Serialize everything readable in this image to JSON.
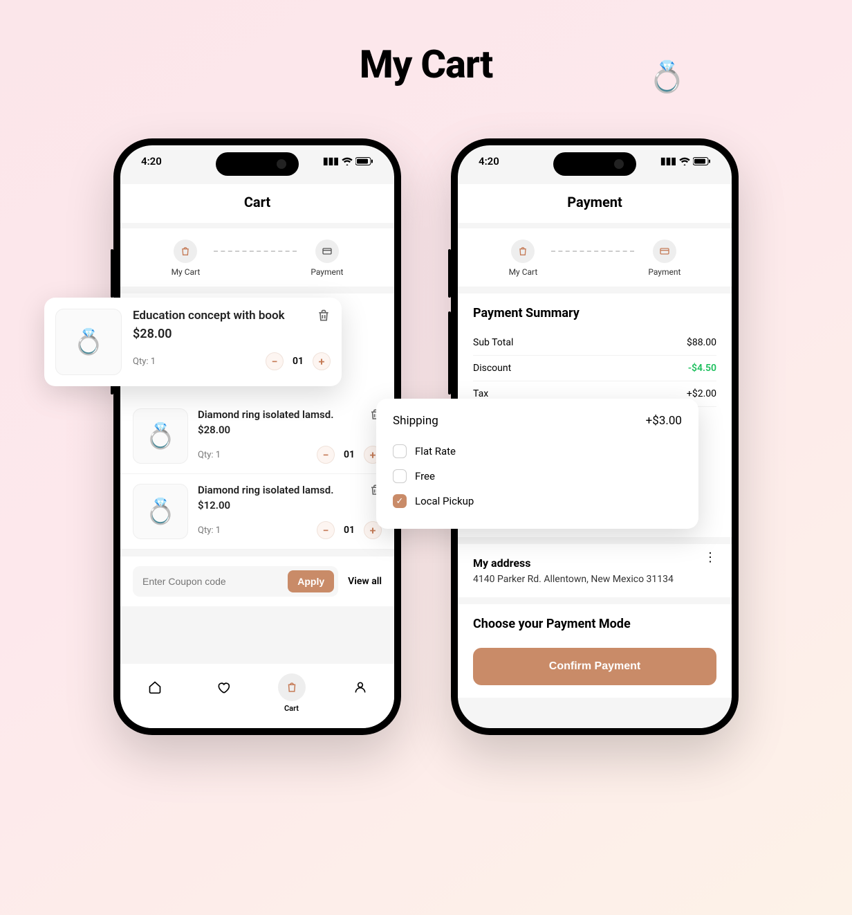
{
  "canvas": {
    "title": "My Cart"
  },
  "status": {
    "time": "4:20"
  },
  "screen1": {
    "header": "Cart",
    "steps": {
      "cart": "My Cart",
      "payment": "Payment"
    },
    "featured": {
      "title": "Education concept with book",
      "price": "$28.00",
      "qty_label": "Qty: 1",
      "qty_value": "01"
    },
    "items": [
      {
        "title": "Diamond ring isolated lamsd.",
        "price": "$28.00",
        "qty_label": "Qty: 1",
        "qty_value": "01"
      },
      {
        "title": "Diamond ring isolated lamsd.",
        "price": "$12.00",
        "qty_label": "Qty: 1",
        "qty_value": "01"
      }
    ],
    "coupon_placeholder": "Enter Coupon code",
    "apply": "Apply",
    "viewall": "View all",
    "nav": {
      "cart": "Cart"
    }
  },
  "screen2": {
    "header": "Payment",
    "steps": {
      "cart": "My Cart",
      "payment": "Payment"
    },
    "summary_title": "Payment Summary",
    "summary": {
      "subtotal_label": "Sub Total",
      "subtotal_value": "$88.00",
      "discount_label": "Discount",
      "discount_value": "-$4.50",
      "tax_label": "Tax",
      "tax_value": "+$2.00"
    },
    "shipping": {
      "title": "Shipping",
      "amount": "+$3.00",
      "options": [
        "Flat Rate",
        "Free",
        "Local Pickup"
      ],
      "selected": "Local Pickup"
    },
    "address_title": "My address",
    "address_text": "4140 Parker Rd. Allentown, New Mexico 31134",
    "payment_mode_title": "Choose your Payment Mode",
    "confirm": "Confirm Payment"
  }
}
